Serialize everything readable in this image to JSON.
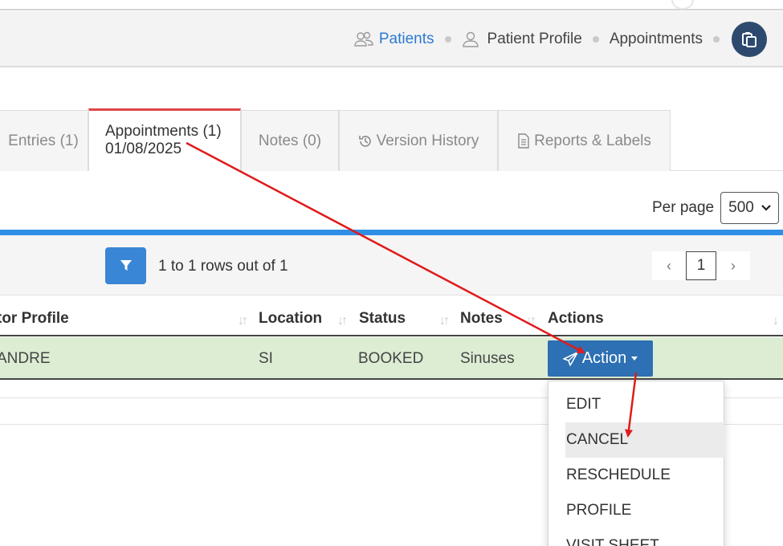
{
  "breadcrumb": {
    "items": [
      {
        "label": "Patients",
        "icon": "users-icon",
        "active": true
      },
      {
        "label": "Patient Profile",
        "icon": "user-icon",
        "active": false
      },
      {
        "label": "Appointments",
        "icon": "",
        "active": false
      }
    ],
    "action_icon": "clipboard-copy-icon"
  },
  "tabs": {
    "entries": "Entries (1)",
    "appointments_line1": "Appointments (1)",
    "appointments_line2": "01/08/2025",
    "notes": "Notes (0)",
    "version_history": "Version History",
    "reports_labels": "Reports & Labels"
  },
  "per_page": {
    "label": "Per page",
    "value": "500"
  },
  "toolbar": {
    "rows_info": "1 to 1 rows out of 1",
    "page_prev": "‹",
    "current_page": "1",
    "page_next": "›"
  },
  "table": {
    "headers": [
      "tor Profile",
      "Location",
      "Status",
      "Notes",
      "Actions"
    ],
    "rows": [
      {
        "doctor_profile": "ANDRE",
        "location": "SI",
        "status": "BOOKED",
        "notes": "Sinuses"
      }
    ],
    "action_button": "Action"
  },
  "action_menu": [
    "EDIT",
    "CANCEL",
    "RESCHEDULE",
    "PROFILE",
    "VISIT SHEET"
  ],
  "colors": {
    "accent_blue": "#2f8fe6",
    "action_button": "#2d70b3",
    "active_tab_border": "#e04545",
    "row_highlight": "#dcedd4",
    "annotation_arrow": "#e01b1b"
  }
}
